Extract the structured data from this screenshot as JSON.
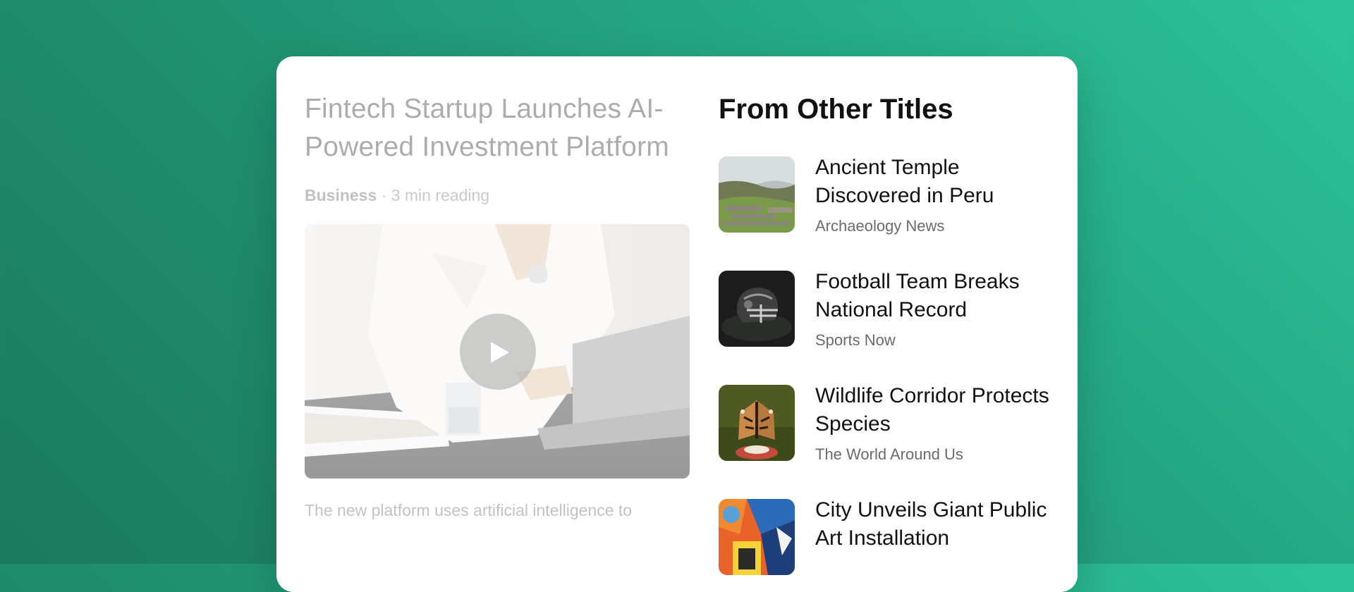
{
  "article": {
    "title": "Fintech Startup Launches AI-Powered Investment Platform",
    "category": "Business",
    "separator": "·",
    "read_time": "3 min reading",
    "media": {
      "icon": "play-icon"
    },
    "excerpt": "The new platform uses artificial intelligence to"
  },
  "sidebar": {
    "heading": "From Other Titles",
    "items": [
      {
        "title": "Ancient Temple Discovered in Peru",
        "source": "Archaeology News",
        "thumb": "ruins-image"
      },
      {
        "title": "Football Team Breaks National Record",
        "source": "Sports Now",
        "thumb": "football-helmet-image"
      },
      {
        "title": "Wildlife Corridor Protects Species",
        "source": "The World Around Us",
        "thumb": "butterfly-image"
      },
      {
        "title": "City Unveils Giant Public Art Installation",
        "source": "",
        "thumb": "street-art-image"
      }
    ]
  },
  "colors": {
    "background_start": "#2dc49a",
    "background_end": "#1b7a5c",
    "card": "#ffffff",
    "heading": "#111111",
    "muted": "#6b6b6b"
  }
}
